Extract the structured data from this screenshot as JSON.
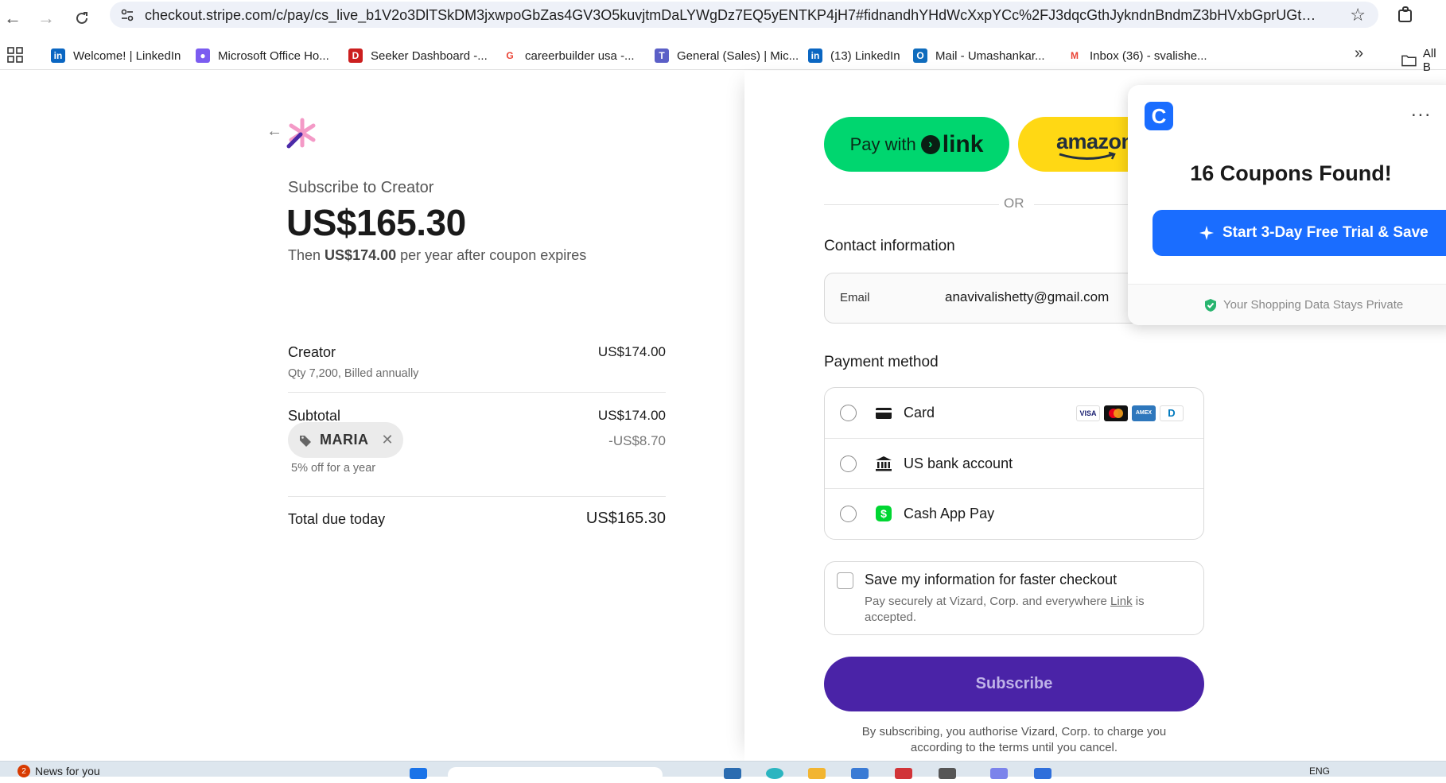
{
  "browser": {
    "url": "checkout.stripe.com/c/pay/cs_live_b1V2o3DlTSkDM3jxwpoGbZas4GV3O5kuvjtmDaLYWgDz7EQ5yENTKP4jH7#fidnandhYHdWcXxpYCc%2FJ3dqcGthJykndnBndmZ3bHVxbGprUGtsdHBga2B2dkB...",
    "bookmarks": [
      {
        "label": "Welcome! | LinkedIn",
        "icon": "linkedin-icon",
        "color": "#0a66c2",
        "glyph": "in"
      },
      {
        "label": "Microsoft Office Ho...",
        "icon": "office-icon",
        "color": "#7b5cf0",
        "glyph": "●"
      },
      {
        "label": "Seeker Dashboard -...",
        "icon": "dice-icon",
        "color": "#cc1f1f",
        "glyph": "D"
      },
      {
        "label": "careerbuilder usa -...",
        "icon": "google-icon",
        "color": "#ffffff",
        "glyph": "G"
      },
      {
        "label": "General (Sales) | Mic...",
        "icon": "teams-icon",
        "color": "#5b5fc7",
        "glyph": "T"
      },
      {
        "label": "(13) LinkedIn",
        "icon": "linkedin-icon",
        "color": "#0a66c2",
        "glyph": "in"
      },
      {
        "label": "Mail - Umashankar...",
        "icon": "outlook-icon",
        "color": "#0f6cbd",
        "glyph": "O"
      },
      {
        "label": "Inbox (36) - svalishe...",
        "icon": "gmail-icon",
        "color": "#ffffff",
        "glyph": "M"
      }
    ],
    "more": "»",
    "all_bookmarks": "All B"
  },
  "summary": {
    "subscribe_to": "Subscribe to Creator",
    "price": "US$165.30",
    "then_prefix": "Then",
    "then_amount": "US$174.00",
    "then_suffix": "per year after coupon expires",
    "item_name": "Creator",
    "item_desc": "Qty 7,200, Billed annually",
    "item_amount": "US$174.00",
    "subtotal_label": "Subtotal",
    "subtotal_amount": "US$174.00",
    "coupon_code": "MARIA",
    "coupon_desc": "5% off for a year",
    "coupon_amount": "-US$8.70",
    "total_label": "Total due today",
    "total_amount": "US$165.30"
  },
  "checkout": {
    "pay_with": "Pay with",
    "link_word": "link",
    "amazon_word": "amazon",
    "or": "OR",
    "contact_heading": "Contact information",
    "email_label": "Email",
    "email_value": "anavivalishetty@gmail.com",
    "payment_heading": "Payment method",
    "methods": [
      {
        "label": "Card",
        "icon": "credit-card-icon"
      },
      {
        "label": "US bank account",
        "icon": "bank-icon"
      },
      {
        "label": "Cash App Pay",
        "icon": "cash-app-icon"
      }
    ],
    "card_brands": [
      {
        "name": "visa",
        "text": "VISA"
      },
      {
        "name": "mastercard",
        "text": ""
      },
      {
        "name": "amex",
        "text": "AMEX"
      },
      {
        "name": "diners",
        "text": "D"
      }
    ],
    "save_title": "Save my information for faster checkout",
    "save_desc_prefix": "Pay securely at Vizard, Corp. and everywhere",
    "save_desc_link": "Link",
    "save_desc_suffix": "is accepted.",
    "subscribe_label": "Subscribe",
    "terms": "By subscribing, you authorise Vizard, Corp. to charge you according to the terms until you cancel."
  },
  "extension": {
    "logo": "C",
    "menu": "...",
    "title": "16 Coupons Found!",
    "cta": "Start 3-Day Free Trial & Save",
    "footer": "Your Shopping Data Stays Private"
  },
  "taskbar": {
    "news": "News for you",
    "news_badge": "2",
    "lang": "ENG"
  },
  "colors": {
    "link_green": "#00d66f",
    "amazon_yellow": "#ffd814",
    "subscribe_purple": "#4a23a7",
    "extension_blue": "#1a6dff"
  }
}
